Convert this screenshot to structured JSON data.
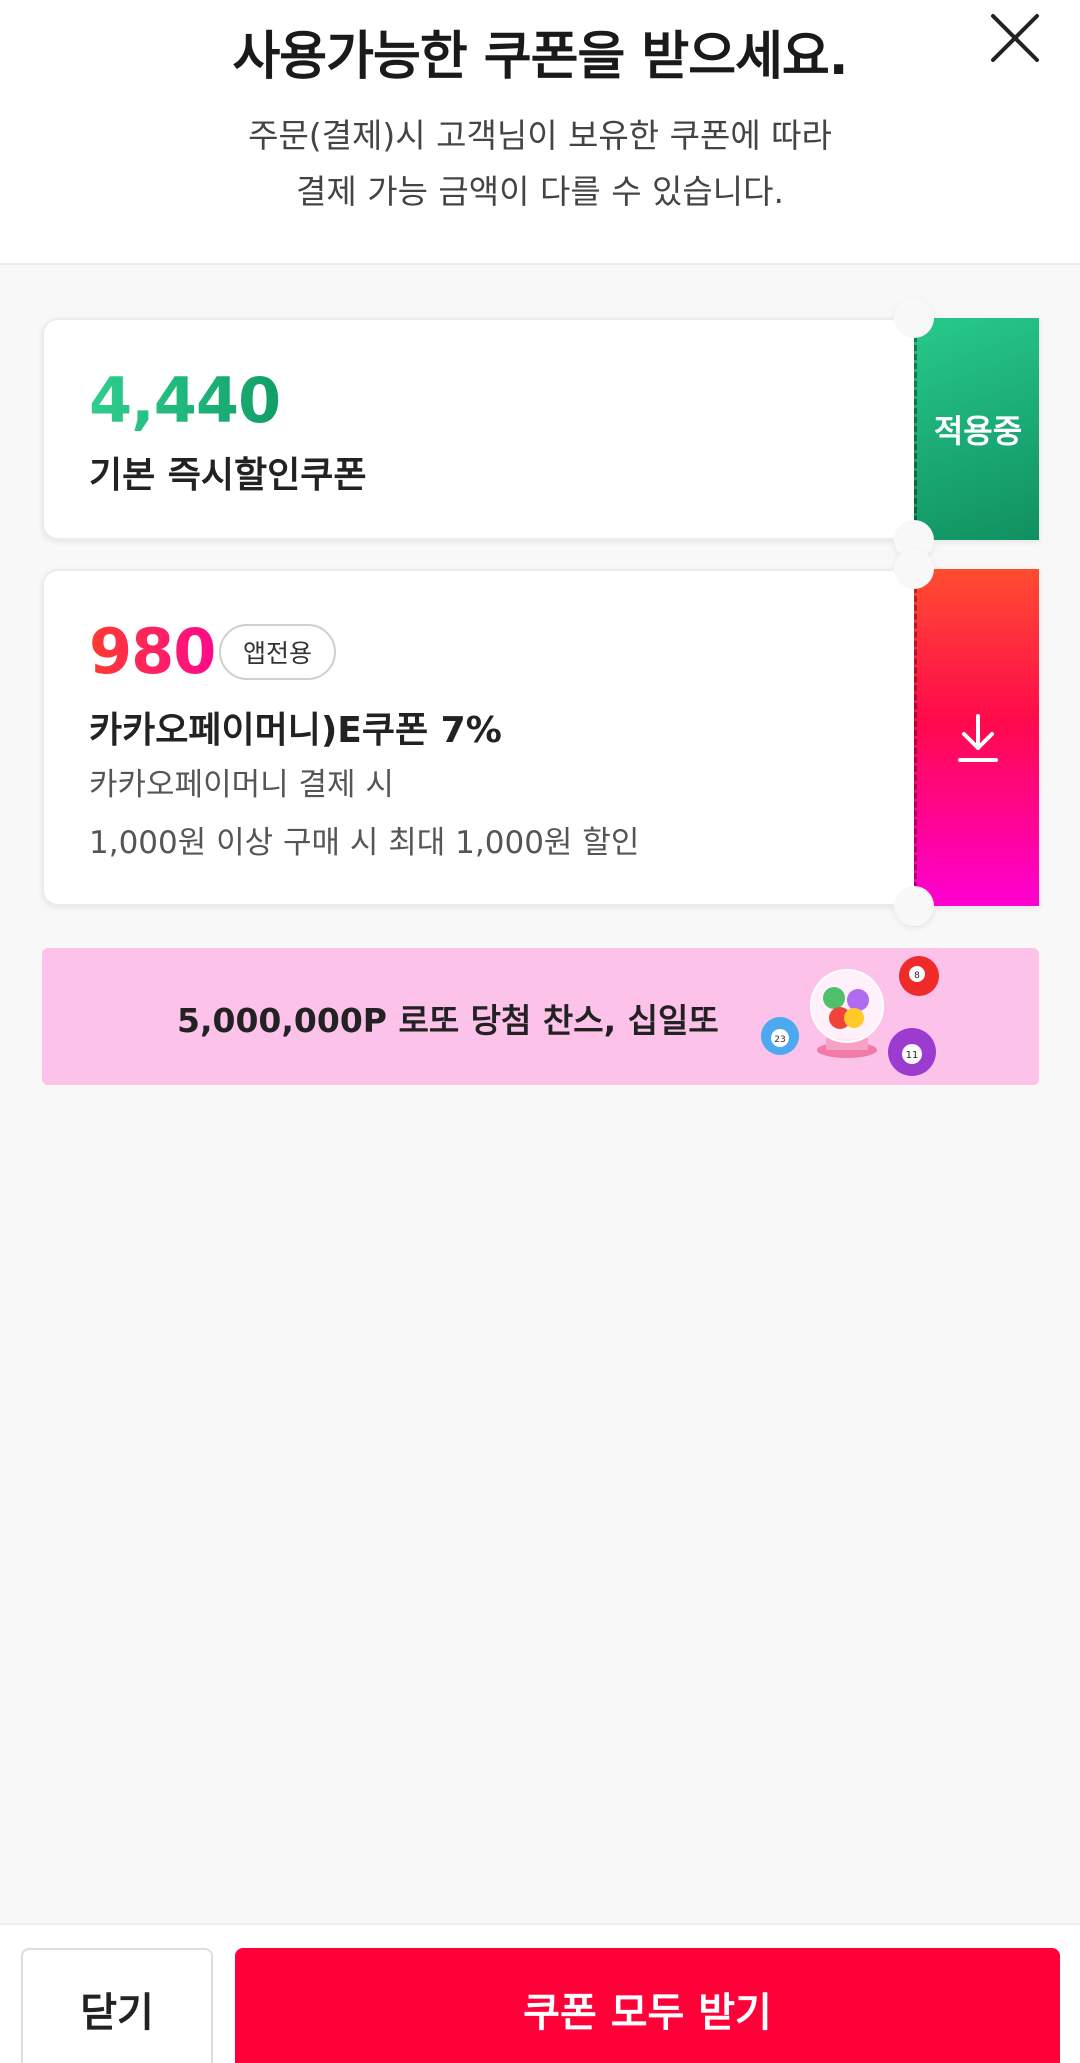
{
  "header": {
    "title": "사용가능한 쿠폰을 받으세요.",
    "subtitle_line1": "주문(결제)시 고객님이 보유한 쿠폰에 따라",
    "subtitle_line2": "결제 가능 금액이 다를 수 있습니다.",
    "close_icon": "close-icon"
  },
  "coupons": [
    {
      "amount": "4,440",
      "name": "기본 즉시할인쿠폰",
      "status": "적용중",
      "color": "#16a56f"
    },
    {
      "amount": "980",
      "badge": "앱전용",
      "name": "카카오페이머니)E쿠폰 7%",
      "desc1": "카카오페이머니 결제 시",
      "desc2": "1,000원 이상 구매 시 최대 1,000원 할인",
      "action_icon": "download-icon",
      "color": "#ff0a4c"
    }
  ],
  "banner": {
    "text": "5,000,000P 로또 당첨 찬스, 십일또",
    "background": "#fdc2e9",
    "ball_numbers": [
      "8",
      "23",
      "11"
    ]
  },
  "footer": {
    "close_label": "닫기",
    "get_all_label": "쿠폰 모두 받기",
    "accent": "#ff0038"
  }
}
